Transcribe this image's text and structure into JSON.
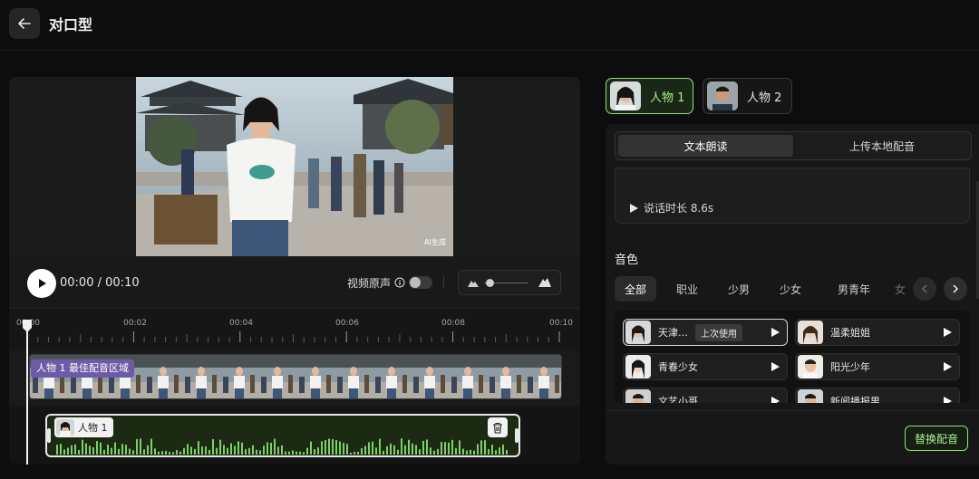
{
  "header": {
    "title": "对口型"
  },
  "player": {
    "time_current": "00:00",
    "time_separator": "/",
    "time_total": "00:10",
    "original_audio_label": "视频原声",
    "watermark": "AI生成"
  },
  "timeline": {
    "ticks": [
      "00:00",
      "00:02",
      "00:04",
      "00:06",
      "00:08",
      "00:10"
    ],
    "region_label": "人物 1 最佳配音区域",
    "audio_clip_speaker": "人物 1"
  },
  "characters": [
    {
      "label": "人物 1"
    },
    {
      "label": "人物 2"
    }
  ],
  "mode_tabs": [
    "文本朗读",
    "上传本地配音"
  ],
  "script": {
    "duration_label": "说话时长 8.6s"
  },
  "voices_section": {
    "title": "音色",
    "filters": [
      "全部",
      "职业",
      "少男",
      "少女",
      "男青年",
      "女"
    ],
    "cards": [
      {
        "name": "天津…",
        "badge": "上次使用"
      },
      {
        "name": "温柔姐姐"
      },
      {
        "name": "青春少女"
      },
      {
        "name": "阳光少年"
      },
      {
        "name": "文艺小哥"
      },
      {
        "name": "新闻播报男"
      }
    ]
  },
  "actions": {
    "replace_label": "替换配音"
  },
  "colors": {
    "accent_green": "#8fe07a",
    "region_purple": "#6e5ba8"
  }
}
